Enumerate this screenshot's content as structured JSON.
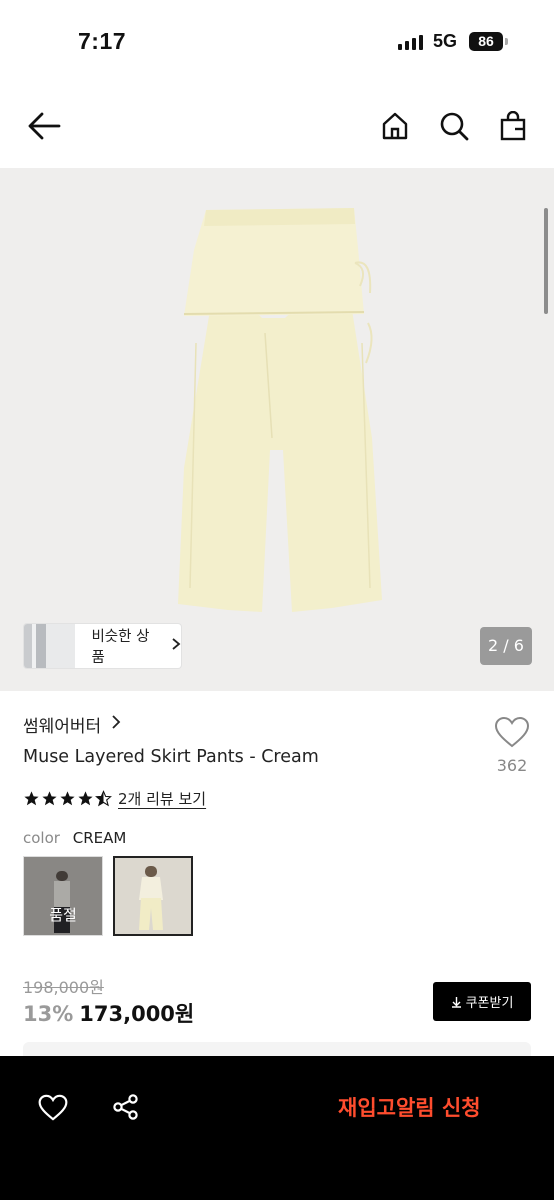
{
  "status_bar": {
    "time": "7:17",
    "network": "5G",
    "battery": "86"
  },
  "nav": {
    "back_icon": "arrow-left-icon",
    "home_icon": "home-icon",
    "search_icon": "search-icon",
    "bag_icon": "shopping-bag-icon"
  },
  "gallery": {
    "similar_label": "비슷한 상품",
    "page_counter": "2 / 6",
    "image_desc_color": "#f3efcc"
  },
  "product": {
    "brand": "썸웨어버터",
    "title": "Muse Layered Skirt Pants - Cream",
    "wish_count": "362",
    "rating": 4.5,
    "review_link": "2개 리뷰 보기",
    "color_label": "color",
    "color_value": "CREAM",
    "swatches": [
      {
        "label": "품절",
        "sold_out": true
      },
      {
        "label": "",
        "selected": true
      }
    ],
    "original_price": "198,000원",
    "discount": "13%",
    "sale_price": "173,000원",
    "coupon_label": "쿠폰받기"
  },
  "bottom_bar": {
    "restock_label": "재입고알림 신청",
    "restock_color": "#ff4d2e"
  }
}
